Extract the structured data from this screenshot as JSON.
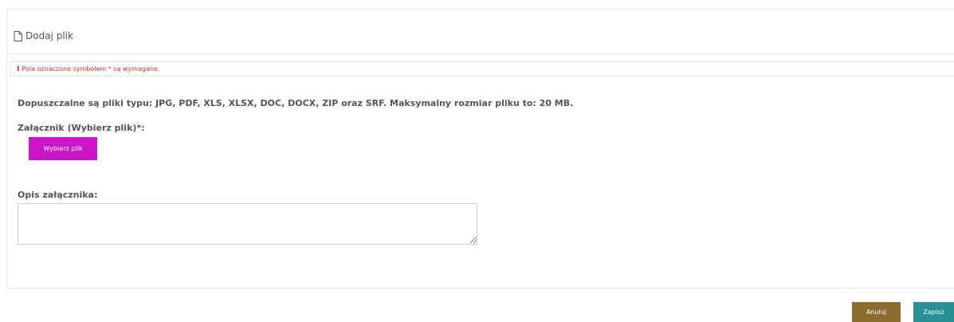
{
  "panel": {
    "title": "Dodaj plik",
    "title_icon": "file-icon"
  },
  "notice": {
    "icon": "info-icon",
    "icon_glyph": "i",
    "text": "Pola oznaczone symbolem * są wymagane.",
    "color": "#c9302c"
  },
  "form": {
    "allowed_types_text": "Dopuszczalne są pliki typu: JPG, PDF, XLS, XLSX, DOC, DOCX, ZIP oraz SRF. Maksymalny rozmiar pliku to: 20 MB.",
    "attachment_label": "Załącznik (Wybierz plik)*:",
    "choose_file_label": "Wybierz plik",
    "description_label": "Opis załącznika:",
    "description_value": ""
  },
  "actions": {
    "cancel_label": "Anuluj",
    "save_label": "Zapisz"
  },
  "colors": {
    "choose_button": "#cc14c8",
    "cancel_button": "#8c6c2e",
    "save_button": "#2a8f96"
  }
}
